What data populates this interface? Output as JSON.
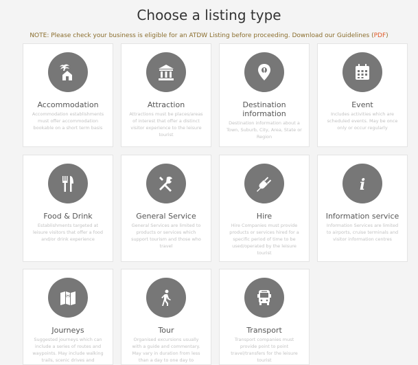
{
  "page": {
    "title": "Choose a listing type",
    "note_text": "NOTE: Please check your business is eligible for an ATDW Listing before proceeding. Download our Guidelines (",
    "note_link": "PDF",
    "note_end": ")"
  },
  "colors": {
    "icon_bg": "#777777",
    "note_text": "#8a6d2c",
    "pdf_link": "#e05a28"
  },
  "cards": [
    {
      "title": "Accommodation",
      "icon": "palm-house-icon",
      "desc": "Accommodation establishments must offer accommodation bookable on a short term basis"
    },
    {
      "title": "Attraction",
      "icon": "museum-icon",
      "desc": "Attractions must be places/areas of interest that offer a distinct visitor experience to the leisure tourist"
    },
    {
      "title": "Destination information",
      "icon": "map-pin-icon",
      "desc": "Destination information about a Town, Suburb, City, Area, State or Region"
    },
    {
      "title": "Event",
      "icon": "calendar-icon",
      "desc": "Includes activities which are scheduled events. May be once only or occur regularly"
    },
    {
      "title": "Food & Drink",
      "icon": "fork-knife-icon",
      "desc": "Establishments targeted at leisure visitors that offer a food and/or drink experience"
    },
    {
      "title": "General Service",
      "icon": "tools-icon",
      "desc": "General Services are limited to products or services which support tourism and those who travel"
    },
    {
      "title": "Hire",
      "icon": "plug-icon",
      "desc": "Hire Companies must provide products or services hired for a specific period of time to be used/operated by the leisure tourist"
    },
    {
      "title": "Information service",
      "icon": "info-icon",
      "desc": "Information Services are limited to airports, cruise terminals and visitor information centres"
    },
    {
      "title": "Journeys",
      "icon": "map-icon",
      "desc": "Suggested journeys which can include a series of routes and waypoints. May include walking trails, scenic drives and suggested"
    },
    {
      "title": "Tour",
      "icon": "walker-icon",
      "desc": "Organised excursions usually with a guide and commentary. May vary in duration from less than a day to one day to"
    },
    {
      "title": "Transport",
      "icon": "bus-icon",
      "desc": "Transport companies must provide point to point travel/transfers for the leisure tourist"
    }
  ]
}
